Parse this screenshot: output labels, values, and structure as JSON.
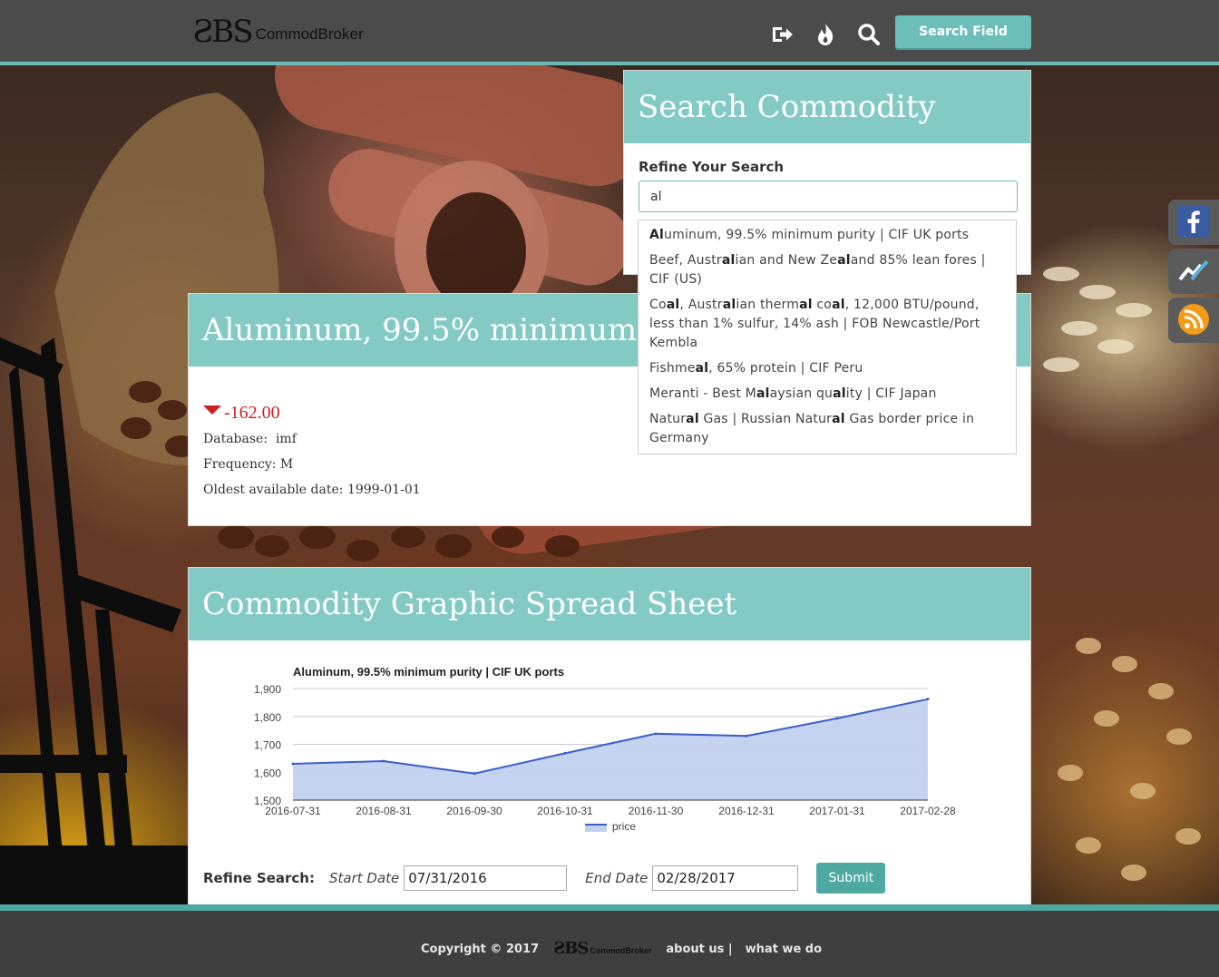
{
  "header": {
    "logo_mark": "ƧBS",
    "logo_text": "CommodBroker",
    "search_field_label": "Search Field",
    "icons": [
      "sign-out-icon",
      "fire-icon",
      "search-icon"
    ]
  },
  "search_panel": {
    "title": "Search Commodity",
    "refine_label": "Refine Your Search",
    "query": "al",
    "suggestions": [
      "Aluminum, 99.5% minimum purity | CIF UK ports",
      "Beef, Australian and New Zealand 85% lean fores | CIF (US)",
      "Coal, Australian thermal coal, 12,000 BTU/pound, less than 1% sulfur, 14% ash | FOB Newcastle/Port Kembla",
      "Fishmeal, 65% protein | CIF Peru",
      "Meranti - Best Malaysian quality | CIF Japan",
      "Natural Gas | Russian Natural Gas border price in Germany"
    ]
  },
  "commodity": {
    "title": "Aluminum, 99.5% minimum purity | CIF UK ports",
    "change": "-162.00",
    "database_label": "Database:",
    "database": "imf",
    "frequency_label": "Frequency:",
    "frequency": "M",
    "oldest_label": "Oldest available date:",
    "oldest": "1999-01-01"
  },
  "graph_panel": {
    "title": "Commodity Graphic Spread Sheet",
    "refine_label": "Refine Search:",
    "start_label": "Start Date",
    "start_value": "07/31/2016",
    "end_label": "End Date",
    "end_value": "02/28/2017",
    "submit_label": "Submit"
  },
  "chart_data": {
    "type": "area",
    "title": "Aluminum, 99.5% minimum purity | CIF UK ports",
    "x": [
      "2016-07-31",
      "2016-08-31",
      "2016-09-30",
      "2016-10-31",
      "2016-11-30",
      "2016-12-31",
      "2017-01-31",
      "2017-02-28"
    ],
    "series": [
      {
        "name": "price",
        "values": [
          1630,
          1640,
          1595,
          1668,
          1738,
          1730,
          1793,
          1862
        ]
      }
    ],
    "ylim": [
      1500,
      1900
    ],
    "yticks": [
      "1,500",
      "1,600",
      "1,700",
      "1,800",
      "1,900"
    ],
    "grid": true,
    "legend": "bottom",
    "colors": {
      "line": "#3a5fc8",
      "fill": "#c2d0ef"
    }
  },
  "social": [
    "facebook-icon",
    "chart-icon",
    "rss-icon"
  ],
  "footer": {
    "copyright": "Copyright © 2017",
    "logo_mark": "ƧBS",
    "logo_text": "CommodBroker",
    "about": "about us |",
    "what": "what we do"
  }
}
